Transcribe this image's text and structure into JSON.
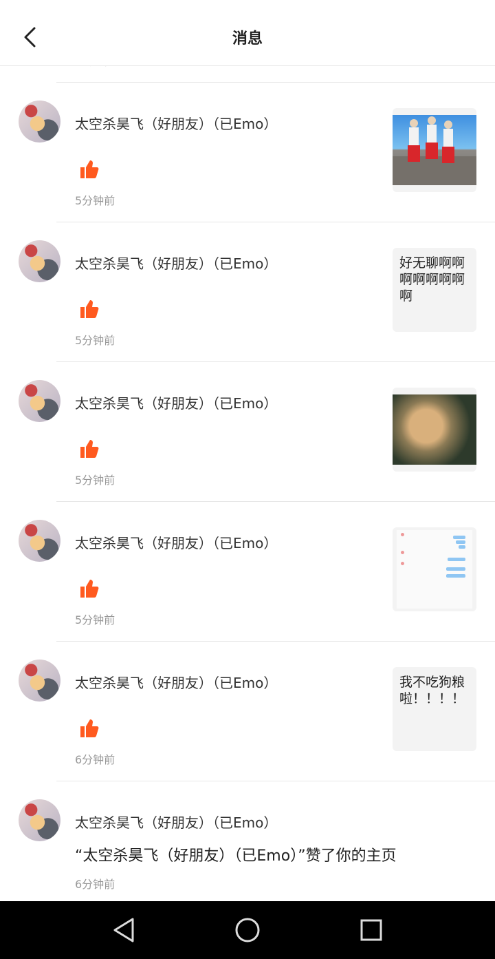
{
  "header": {
    "title": "消息"
  },
  "clipped_text": "…分钟前",
  "likes": [
    {
      "user": "太空杀昊飞（好朋友）（已Emo）",
      "time": "5分钟前",
      "thumb": {
        "type": "image",
        "desc": "dancing-characters-image"
      }
    },
    {
      "user": "太空杀昊飞（好朋友）（已Emo）",
      "time": "5分钟前",
      "thumb": {
        "type": "text",
        "text": "好无聊啊啊啊啊啊啊啊啊"
      }
    },
    {
      "user": "太空杀昊飞（好朋友）（已Emo）",
      "time": "5分钟前",
      "thumb": {
        "type": "image",
        "desc": "face-closeup-image"
      }
    },
    {
      "user": "太空杀昊飞（好朋友）（已Emo）",
      "time": "5分钟前",
      "thumb": {
        "type": "image",
        "desc": "chat-screenshot-image"
      }
    },
    {
      "user": "太空杀昊飞（好朋友）（已Emo）",
      "time": "6分钟前",
      "thumb": {
        "type": "text",
        "text": "我不吃狗粮啦！！！！"
      }
    }
  ],
  "homepage_like": {
    "user": "太空杀昊飞（好朋友）（已Emo）",
    "comment": "“太空杀昊飞（好朋友）（已Emo）”赞了你的主页",
    "time": "6分钟前"
  },
  "colors": {
    "accent": "#ff5a1f"
  },
  "icons": {
    "back": "back-arrow-icon",
    "like": "thumbs-up-icon"
  }
}
